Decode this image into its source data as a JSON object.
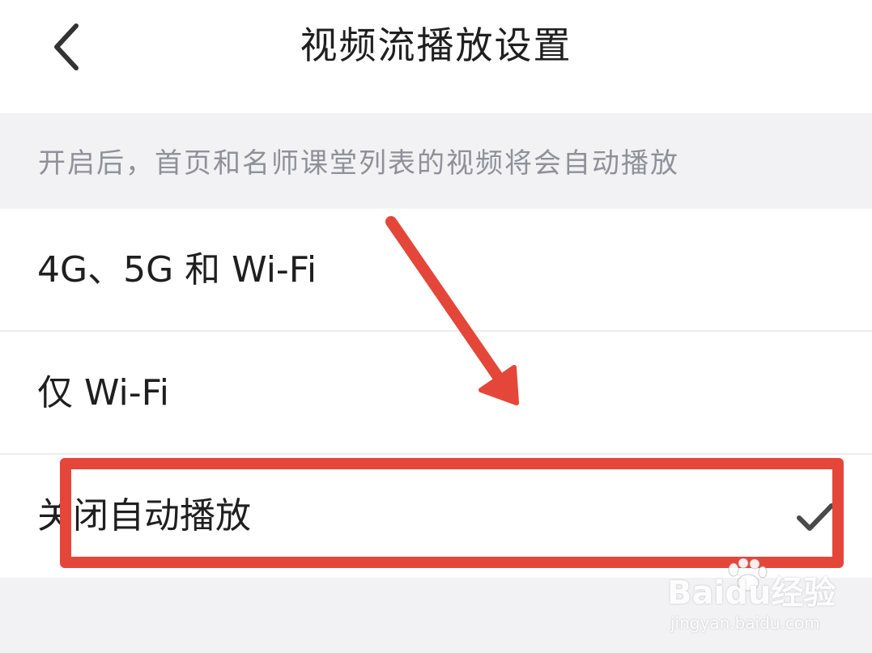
{
  "navbar": {
    "title": "视频流播放设置",
    "back_icon": "chevron-left-icon"
  },
  "hint": {
    "text": "开启后，首页和名师课堂列表的视频将会自动播放"
  },
  "options": [
    {
      "label": "4G、5G 和 Wi-Fi",
      "selected": false
    },
    {
      "label": "仅 Wi-Fi",
      "selected": false
    },
    {
      "label": "关闭自动播放",
      "selected": true
    }
  ],
  "annotation": {
    "color": "#e5463a"
  },
  "watermark": {
    "brand": "Baidu经验",
    "url": "jingyan.baidu.com"
  }
}
